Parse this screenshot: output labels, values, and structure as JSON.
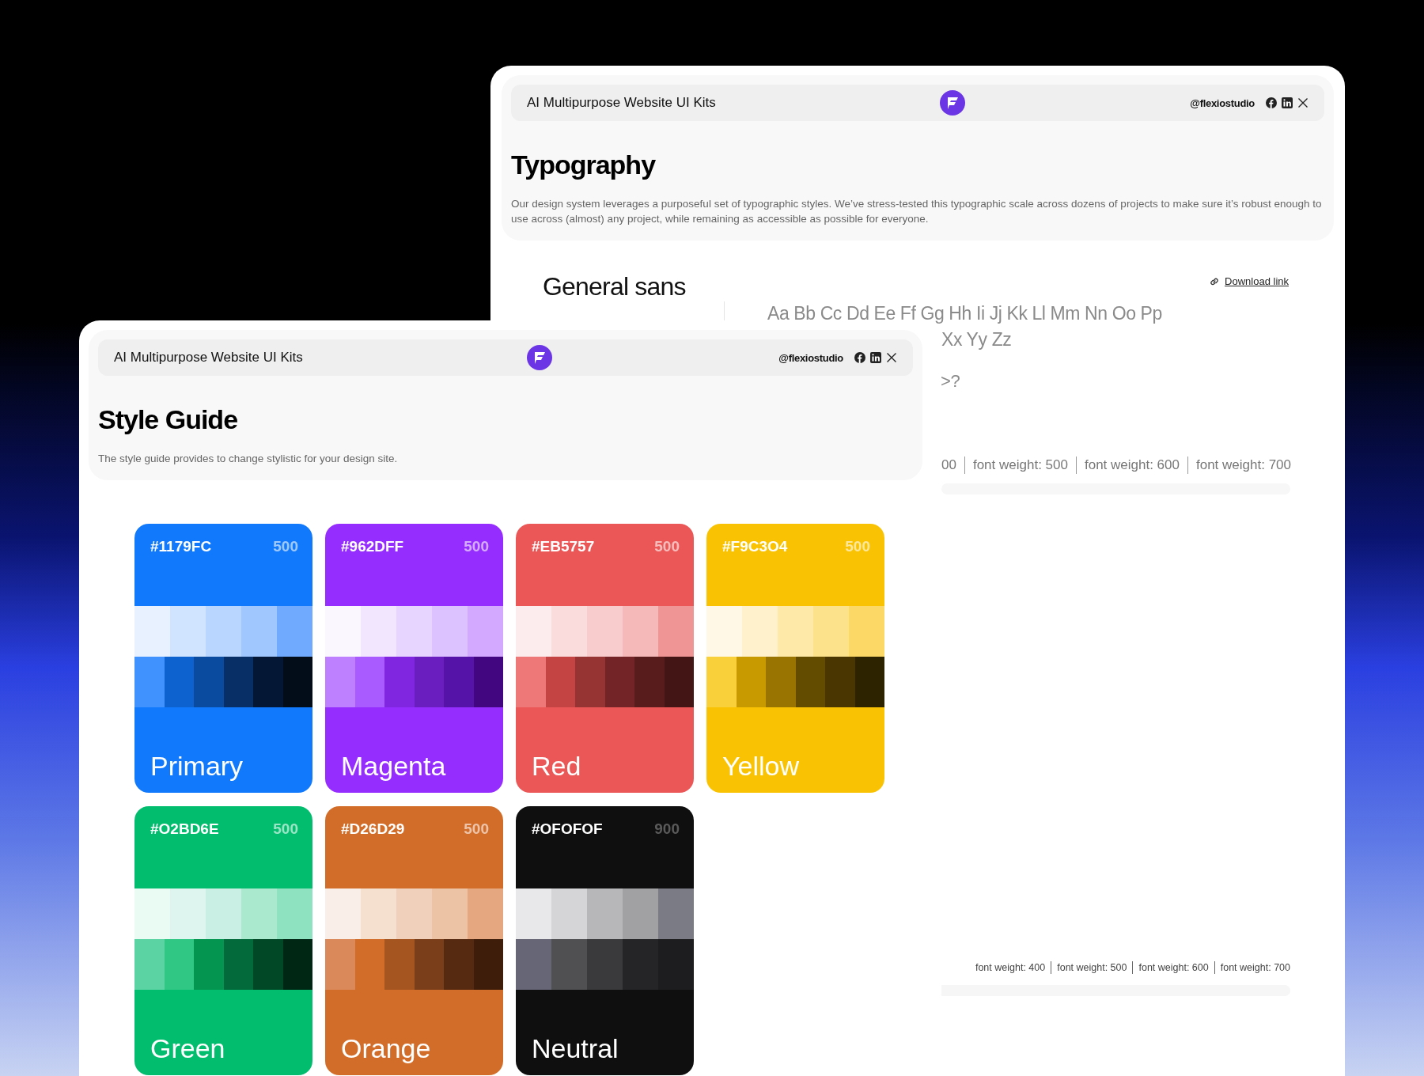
{
  "back_window": {
    "header": {
      "title": "AI Multipurpose Website UI Kits",
      "handle": "@flexiostudio"
    },
    "heading": "Typography",
    "intro": "Our design system leverages a purposeful set of typographic styles. We’ve stress-tested this typographic scale across dozens of projects to make sure it’s robust enough to use across (almost) any project, while remaining as accessible as possible for everyone.",
    "font_name": "General sans",
    "download_link": "Download link",
    "alphabet": [
      "Aa Bb Cc Dd Ee Ff Gg Hh Ii Jj Kk Ll Mm Nn Oo Pp",
      "Xx Yy Zz"
    ],
    "symbols": ">?",
    "weights_large": [
      "00",
      "font weight: 500",
      "font weight: 600",
      "font weight: 700"
    ],
    "weights_small": [
      "font weight: 400",
      "font weight: 500",
      "font weight: 600",
      "font weight: 700"
    ]
  },
  "front_window": {
    "header": {
      "title": "AI Multipurpose Website UI Kits",
      "handle": "@flexiostudio"
    },
    "heading": "Style Guide",
    "intro": "The style guide provides to change stylistic for your design site.",
    "palettes": [
      {
        "hex": "#1179FC",
        "tone": "500",
        "name": "Primary",
        "color": "#1179fc",
        "light": [
          {
            "color": "#e8f1ff"
          },
          {
            "color": "#d0e4ff"
          },
          {
            "color": "#b8d6ff"
          },
          {
            "color": "#a0c8ff"
          },
          {
            "color": "#70aaff"
          }
        ],
        "dark": [
          {
            "color": "#4093ff"
          },
          {
            "color": "#0e62d0"
          },
          {
            "color": "#0a4ba0"
          },
          {
            "color": "#082f66"
          },
          {
            "color": "#041836"
          },
          {
            "color": "#030d1a"
          }
        ]
      },
      {
        "hex": "#962DFF",
        "tone": "500",
        "name": "Magenta",
        "color": "#962dff",
        "light": [
          {
            "color": "#fbf7ff"
          },
          {
            "color": "#f2e6ff"
          },
          {
            "color": "#e8d5ff"
          },
          {
            "color": "#dcc2ff"
          },
          {
            "color": "#d3a8ff"
          }
        ],
        "dark": [
          {
            "color": "#be80ff"
          },
          {
            "color": "#a95bff"
          },
          {
            "color": "#8126e0"
          },
          {
            "color": "#6b1ec0"
          },
          {
            "color": "#5513a8"
          },
          {
            "color": "#420680"
          }
        ]
      },
      {
        "hex": "#EB5757",
        "tone": "500",
        "name": "Red",
        "color": "#eb5757",
        "light": [
          {
            "color": "#fdeced"
          },
          {
            "color": "#fbdcdc"
          },
          {
            "color": "#f8cccc"
          },
          {
            "color": "#f5b9b9"
          },
          {
            "color": "#f09595"
          }
        ],
        "dark": [
          {
            "color": "#ee7777"
          },
          {
            "color": "#c44444"
          },
          {
            "color": "#963333"
          },
          {
            "color": "#722426"
          },
          {
            "color": "#581c1c"
          },
          {
            "color": "#431515"
          }
        ]
      },
      {
        "hex": "#F9C3O4",
        "tone": "500",
        "name": "Yellow",
        "color": "#f9c304",
        "light": [
          {
            "color": "#fff8e6"
          },
          {
            "color": "#fff1cc"
          },
          {
            "color": "#ffe9a8"
          },
          {
            "color": "#fde28c"
          },
          {
            "color": "#fcd966"
          }
        ],
        "dark": [
          {
            "color": "#f9d03a"
          },
          {
            "color": "#c99a00"
          },
          {
            "color": "#9a7400"
          },
          {
            "color": "#634b00"
          },
          {
            "color": "#4a3600"
          },
          {
            "color": "#2e2300"
          }
        ]
      },
      {
        "hex": "#O2BD6E",
        "tone": "500",
        "name": "Green",
        "color": "#02bd6e",
        "light": [
          {
            "color": "#eafbf4"
          },
          {
            "color": "#ddf5ee"
          },
          {
            "color": "#c9eee3"
          },
          {
            "color": "#abe9cf"
          },
          {
            "color": "#8fe2bf"
          }
        ],
        "dark": [
          {
            "color": "#5cd3a2"
          },
          {
            "color": "#30c784"
          },
          {
            "color": "#049550"
          },
          {
            "color": "#036b3b"
          },
          {
            "color": "#014826"
          },
          {
            "color": "#002614"
          }
        ]
      },
      {
        "hex": "#D26D29",
        "tone": "500",
        "name": "Orange",
        "color": "#d26d29",
        "light": [
          {
            "color": "#faeee8"
          },
          {
            "color": "#f5e0d0"
          },
          {
            "color": "#f1d0bb"
          },
          {
            "color": "#ecc3a4"
          },
          {
            "color": "#e5a77f"
          }
        ],
        "dark": [
          {
            "color": "#d9895a"
          },
          {
            "color": "#d26d29"
          },
          {
            "color": "#a55520"
          },
          {
            "color": "#7a3f1a"
          },
          {
            "color": "#552a10"
          },
          {
            "color": "#3e1e0b"
          }
        ]
      },
      {
        "hex": "#OFOFOF",
        "tone": "900",
        "name": "Neutral",
        "color": "#0f0f0f",
        "light": [
          {
            "color": "#e8e8ea"
          },
          {
            "color": "#d5d5d7"
          },
          {
            "color": "#b7b7b9"
          },
          {
            "color": "#a1a1a3"
          },
          {
            "color": "#7b7b85"
          }
        ],
        "dark": [
          {
            "color": "#676676"
          },
          {
            "color": "#505052"
          },
          {
            "color": "#3a3a3c"
          },
          {
            "color": "#252527"
          },
          {
            "color": "#1d1d1f"
          }
        ]
      }
    ]
  }
}
